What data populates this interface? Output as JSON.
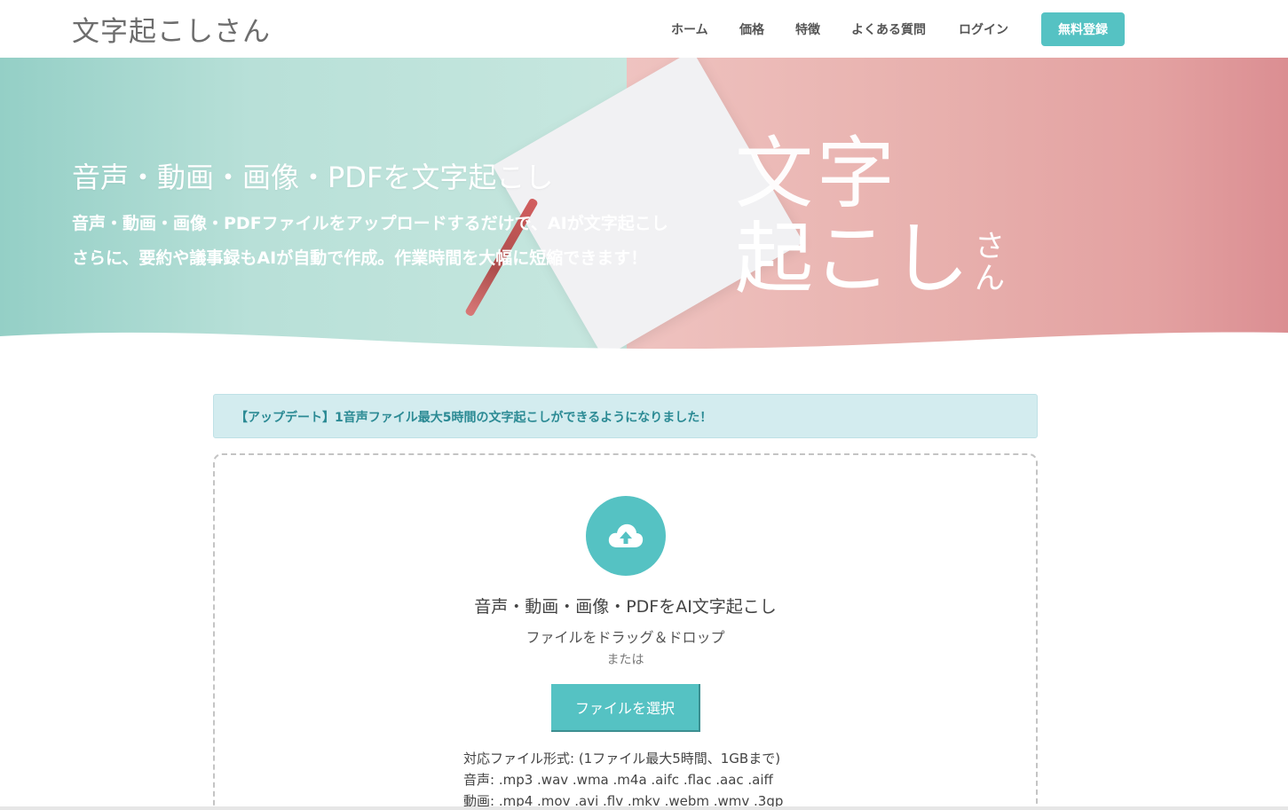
{
  "header": {
    "logo": "文字起こしさん",
    "nav": [
      {
        "label": "ホーム"
      },
      {
        "label": "価格"
      },
      {
        "label": "特徴"
      },
      {
        "label": "よくある質問"
      },
      {
        "label": "ログイン"
      }
    ],
    "signup": "無料登録"
  },
  "hero": {
    "title": "音声・動画・画像・PDFを文字起こし",
    "line1": "音声・動画・画像・PDFファイルをアップロードするだけで、AIが文字起こし",
    "line2": "さらに、要約や議事録もAIが自動で作成。作業時間を大幅に短縮できます！",
    "big_logo_row1": "文字",
    "big_logo_row2": "起こし",
    "big_logo_sa": "さ",
    "big_logo_n": "ん"
  },
  "notice": "【アップデート】1音声ファイル最大5時間の文字起こしができるようになりました！",
  "upload": {
    "title": "音声・動画・画像・PDFをAI文字起こし",
    "subtitle": "ファイルをドラッグ＆ドロップ",
    "or": "または",
    "button": "ファイルを選択",
    "formats_heading": "対応ファイル形式: (1ファイル最大5時間、1GBまで)",
    "formats_audio": "音声: .mp3 .wav .wma .m4a .aifc .flac .aac .aiff",
    "formats_video": "動画: .mp4 .mov .avi .flv .mkv .webm .wmv .3gp"
  },
  "colors": {
    "accent": "#55c2c3",
    "notice_bg": "#d3ecef",
    "notice_text": "#2b8a94"
  },
  "icons": {
    "upload": "cloud-upload-icon"
  }
}
